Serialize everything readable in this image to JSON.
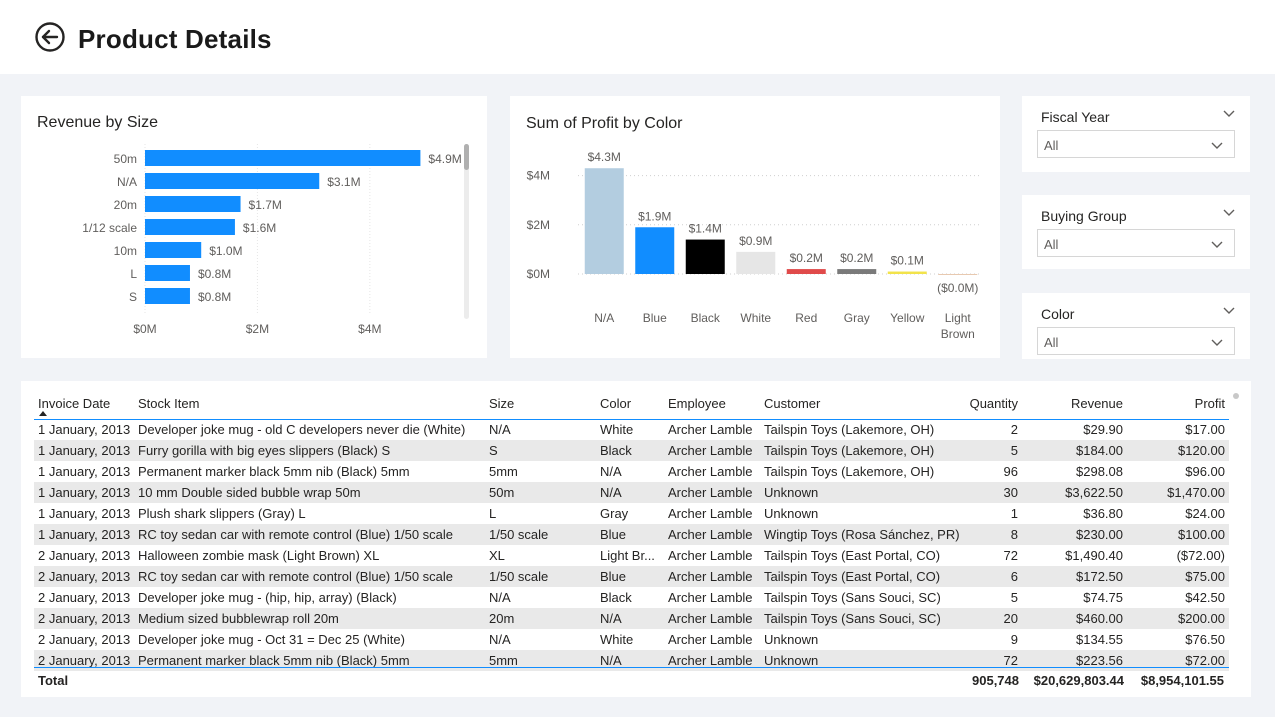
{
  "header": {
    "title": "Product Details"
  },
  "revenue_by_size": {
    "title": "Revenue by Size",
    "chart_data": {
      "type": "bar",
      "orientation": "horizontal",
      "title": "Revenue by Size",
      "categories": [
        "50m",
        "N/A",
        "20m",
        "1/12 scale",
        "10m",
        "L",
        "S"
      ],
      "values": [
        4.9,
        3.1,
        1.7,
        1.6,
        1.0,
        0.8,
        0.8
      ],
      "labels": [
        "$4.9M",
        "$3.1M",
        "$1.7M",
        "$1.6M",
        "$1.0M",
        "$0.8M",
        "$0.8M"
      ],
      "xticks": [
        "$0M",
        "$2M",
        "$4M"
      ],
      "xtick_values": [
        0,
        2,
        4
      ],
      "xlim": [
        0,
        5.8
      ],
      "color": "#118dff",
      "grid": true
    }
  },
  "profit_by_color": {
    "title": "Sum of Profit by Color",
    "chart_data": {
      "type": "bar",
      "title": "Sum of Profit by Color",
      "categories": [
        "N/A",
        "Blue",
        "Black",
        "White",
        "Red",
        "Gray",
        "Yellow",
        "Light Brown"
      ],
      "category_lines": [
        [
          "N/A"
        ],
        [
          "Blue"
        ],
        [
          "Black"
        ],
        [
          "White"
        ],
        [
          "Red"
        ],
        [
          "Gray"
        ],
        [
          "Yellow"
        ],
        [
          "Light",
          "Brown"
        ]
      ],
      "values": [
        4.3,
        1.9,
        1.4,
        0.9,
        0.2,
        0.2,
        0.1,
        -0.02
      ],
      "labels": [
        "$4.3M",
        "$1.9M",
        "$1.4M",
        "$0.9M",
        "$0.2M",
        "$0.2M",
        "$0.1M",
        "($0.0M)"
      ],
      "colors": [
        "#b3cde0",
        "#118dff",
        "#000000",
        "#e6e6e6",
        "#e04a4a",
        "#7a7a7a",
        "#f2e34b",
        "#e8c9b0"
      ],
      "yticks": [
        "$0M",
        "$2M",
        "$4M"
      ],
      "ytick_values": [
        0,
        2,
        4
      ],
      "grid": true
    }
  },
  "slicers": [
    {
      "title": "Fiscal Year",
      "value": "All"
    },
    {
      "title": "Buying Group",
      "value": "All"
    },
    {
      "title": "Color",
      "value": "All"
    }
  ],
  "table": {
    "columns": [
      "Invoice Date",
      "Stock Item",
      "Size",
      "Color",
      "Employee",
      "Customer",
      "Quantity",
      "Revenue",
      "Profit"
    ],
    "rows": [
      [
        "1 January, 2013",
        "Developer joke mug - old C developers never die (White)",
        "N/A",
        "White",
        "Archer Lamble",
        "Tailspin Toys (Lakemore, OH)",
        "2",
        "$29.90",
        "$17.00"
      ],
      [
        "1 January, 2013",
        "Furry gorilla with big eyes slippers (Black) S",
        "S",
        "Black",
        "Archer Lamble",
        "Tailspin Toys (Lakemore, OH)",
        "5",
        "$184.00",
        "$120.00"
      ],
      [
        "1 January, 2013",
        "Permanent marker black 5mm nib (Black) 5mm",
        "5mm",
        "N/A",
        "Archer Lamble",
        "Tailspin Toys (Lakemore, OH)",
        "96",
        "$298.08",
        "$96.00"
      ],
      [
        "1 January, 2013",
        "10 mm Double sided bubble wrap 50m",
        "50m",
        "N/A",
        "Archer Lamble",
        "Unknown",
        "30",
        "$3,622.50",
        "$1,470.00"
      ],
      [
        "1 January, 2013",
        "Plush shark slippers (Gray) L",
        "L",
        "Gray",
        "Archer Lamble",
        "Unknown",
        "1",
        "$36.80",
        "$24.00"
      ],
      [
        "1 January, 2013",
        "RC toy sedan car with remote control (Blue) 1/50 scale",
        "1/50 scale",
        "Blue",
        "Archer Lamble",
        "Wingtip Toys (Rosa Sánchez, PR)",
        "8",
        "$230.00",
        "$100.00"
      ],
      [
        "2 January, 2013",
        "Halloween zombie mask (Light Brown) XL",
        "XL",
        "Light Br...",
        "Archer Lamble",
        "Tailspin Toys (East Portal, CO)",
        "72",
        "$1,490.40",
        "($72.00)"
      ],
      [
        "2 January, 2013",
        "RC toy sedan car with remote control (Blue) 1/50 scale",
        "1/50 scale",
        "Blue",
        "Archer Lamble",
        "Tailspin Toys (East Portal, CO)",
        "6",
        "$172.50",
        "$75.00"
      ],
      [
        "2 January, 2013",
        "Developer joke mug - (hip, hip, array) (Black)",
        "N/A",
        "Black",
        "Archer Lamble",
        "Tailspin Toys (Sans Souci, SC)",
        "5",
        "$74.75",
        "$42.50"
      ],
      [
        "2 January, 2013",
        "Medium sized bubblewrap roll 20m",
        "20m",
        "N/A",
        "Archer Lamble",
        "Tailspin Toys (Sans Souci, SC)",
        "20",
        "$460.00",
        "$200.00"
      ],
      [
        "2 January, 2013",
        "Developer joke mug - Oct 31 = Dec 25 (White)",
        "N/A",
        "White",
        "Archer Lamble",
        "Unknown",
        "9",
        "$134.55",
        "$76.50"
      ],
      [
        "2 January, 2013",
        "Permanent marker black 5mm nib (Black) 5mm",
        "5mm",
        "N/A",
        "Archer Lamble",
        "Unknown",
        "72",
        "$223.56",
        "$72.00"
      ]
    ],
    "totals": {
      "label": "Total",
      "quantity": "905,748",
      "revenue": "$20,629,803.44",
      "profit": "$8,954,101.55"
    }
  }
}
